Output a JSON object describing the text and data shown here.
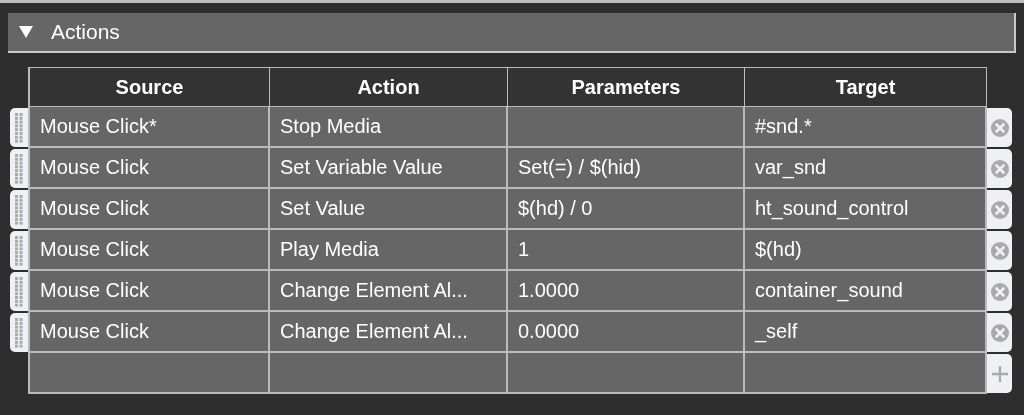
{
  "section": {
    "title": "Actions",
    "expanded": true
  },
  "table": {
    "columns": [
      "Source",
      "Action",
      "Parameters",
      "Target"
    ],
    "rows": [
      {
        "cells": [
          "Mouse Click*",
          "Stop Media",
          "",
          "#snd.*"
        ]
      },
      {
        "cells": [
          "Mouse Click",
          "Set Variable Value",
          "Set(=) / $(hid)",
          "var_snd"
        ]
      },
      {
        "cells": [
          "Mouse Click",
          "Set Value",
          "$(hd) / 0",
          "ht_sound_control"
        ]
      },
      {
        "cells": [
          "Mouse Click",
          "Play Media",
          "1",
          "$(hd)"
        ]
      },
      {
        "cells": [
          "Mouse Click",
          "Change Element Al...",
          "1.0000",
          "container_sound"
        ]
      },
      {
        "cells": [
          "Mouse Click",
          "Change Element Al...",
          "0.0000",
          "_self"
        ]
      }
    ]
  }
}
